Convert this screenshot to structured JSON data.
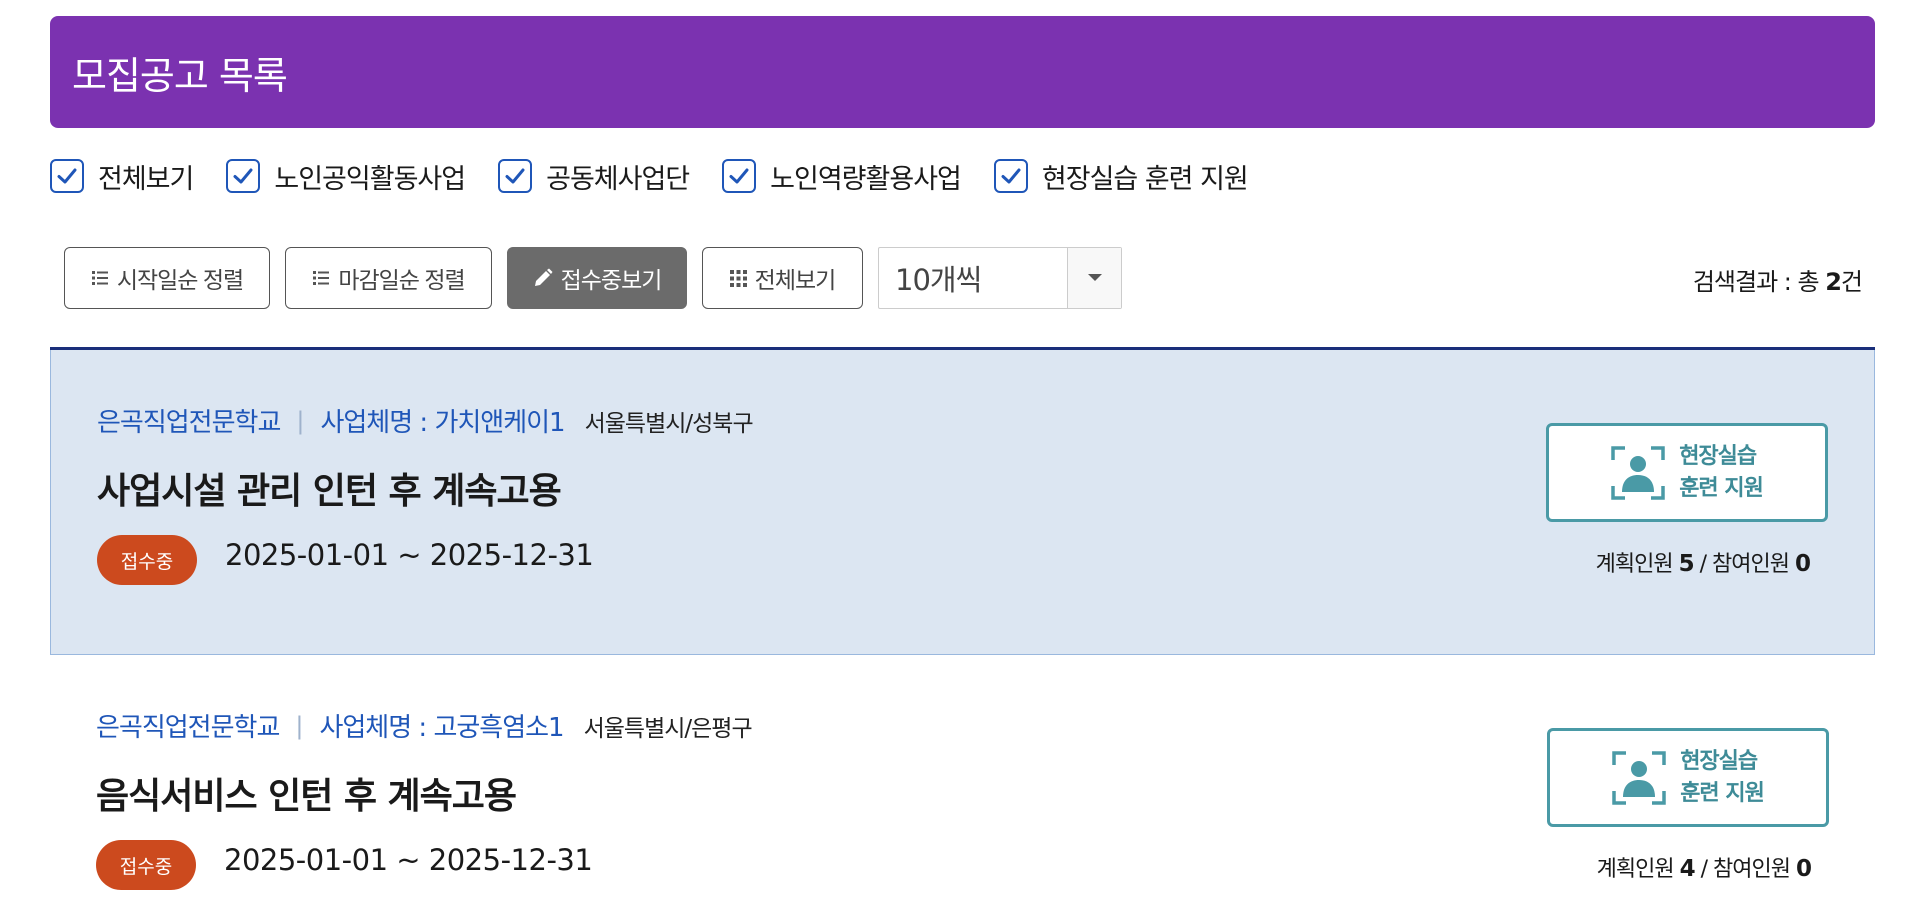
{
  "header": {
    "title": "모집공고 목록"
  },
  "filters": [
    {
      "label": "전체보기",
      "checked": true
    },
    {
      "label": "노인공익활동사업",
      "checked": true
    },
    {
      "label": "공동체사업단",
      "checked": true
    },
    {
      "label": "노인역량활용사업",
      "checked": true
    },
    {
      "label": "현장실습 훈련 지원",
      "checked": true
    }
  ],
  "toolbar": {
    "sort_start": "시작일순 정렬",
    "sort_deadline": "마감일순 정렬",
    "view_open": "접수중보기",
    "view_all": "전체보기",
    "page_size": "10개씩",
    "result_prefix": "검색결과 : 총 ",
    "result_count": "2",
    "result_suffix": "건"
  },
  "postings": [
    {
      "org": "은곡직업전문학교",
      "biz_label": "사업체명 : 가치앤케이1",
      "region": "서울특별시/성북구",
      "title": "사업시설 관리 인턴 후 계속고용",
      "status": "접수중",
      "period": "2025-01-01 ~ 2025-12-31",
      "type_line1": "현장실습",
      "type_line2": "훈련 지원",
      "planned_label": "계획인원 ",
      "planned": "5",
      "divider": " / ",
      "joined_label": "참여인원 ",
      "joined": "0"
    },
    {
      "org": "은곡직업전문학교",
      "biz_label": "사업체명 : 고궁흑염소1",
      "region": "서울특별시/은평구",
      "title": "음식서비스 인턴 후 계속고용",
      "status": "접수중",
      "period": "2025-01-01 ~ 2025-12-31",
      "type_line1": "현장실습",
      "type_line2": "훈련 지원",
      "planned_label": "계획인원 ",
      "planned": "4",
      "divider": " / ",
      "joined_label": "참여인원 ",
      "joined": "0"
    }
  ],
  "colors": {
    "header_bg": "#7b32b0",
    "link_blue": "#1f56b8",
    "status_badge": "#cc4a1e",
    "type_teal": "#4a9aa6",
    "highlight_bg": "#dce6f2"
  },
  "icons": {
    "checkbox": "check-icon",
    "sort": "list-icon",
    "open": "pencil-icon",
    "all": "grid-icon",
    "dropdown": "caret-down-icon",
    "type": "person-frame-icon"
  }
}
